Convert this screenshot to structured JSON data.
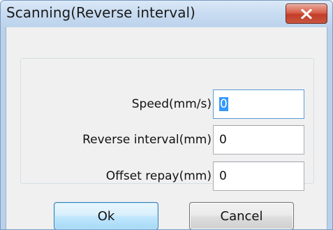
{
  "window": {
    "title": "Scanning(Reverse interval)"
  },
  "form": {
    "speed": {
      "label": "Speed(mm/s)",
      "value": "0"
    },
    "reverse_interval": {
      "label": "Reverse interval(mm)",
      "value": "0"
    },
    "offset_repay": {
      "label": "Offset repay(mm)",
      "value": "0"
    }
  },
  "buttons": {
    "ok_label": "Ok",
    "cancel_label": "Cancel"
  },
  "icons": {
    "close": "close-icon"
  },
  "colors": {
    "title_bar": "#c9dcf1",
    "close_button": "#c7553f",
    "dialog_background": "#f0f0f0",
    "selection": "#3399ff",
    "ok_button_border": "#3c7fb1"
  }
}
